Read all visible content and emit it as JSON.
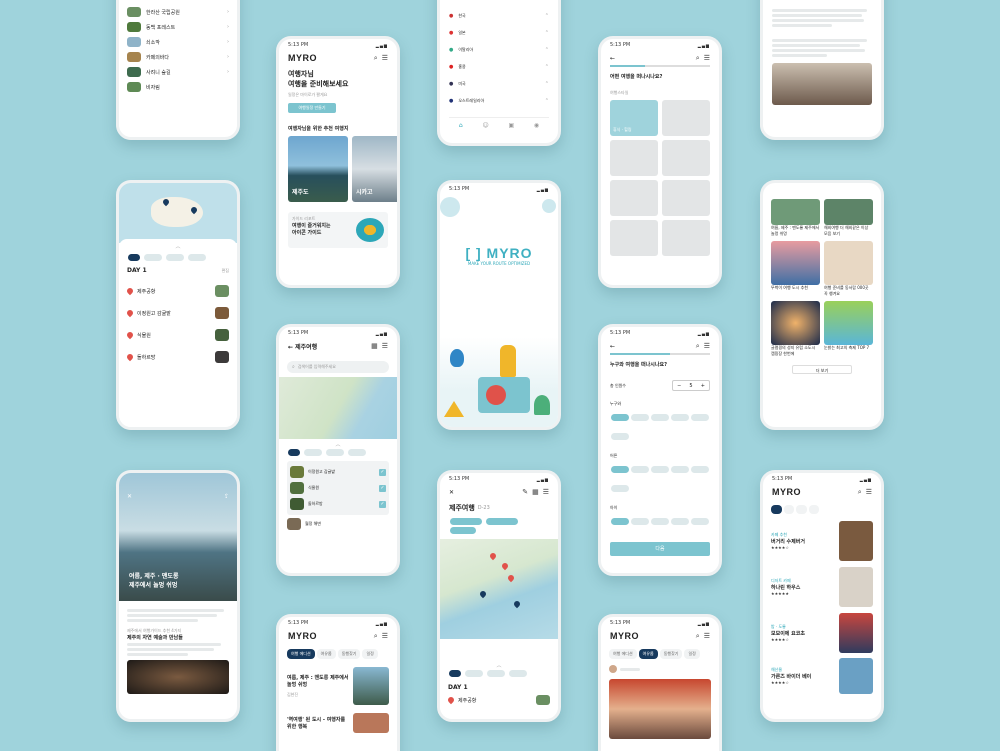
{
  "status_time": "5:13 PM",
  "brand": "MYRO",
  "brand_tagline": "MAKE YOUR ROUTE OPTIMIZED",
  "home": {
    "greeting_line1": "여행자님",
    "greeting_line2": "여행을 준비해보세요",
    "subtitle": "일정은 마이로가 짤게요",
    "cta": "여행일정 만들기",
    "rec_title": "여행자님을 위한 추천 여행지",
    "rec_cards": [
      "제주도",
      "시카고"
    ],
    "guide_small": "가이드 리포트",
    "guide_line1": "여행이 즐거워지는",
    "guide_line2": "아이콘 가이드"
  },
  "countries": [
    "한국",
    "일본",
    "이탈리아",
    "홍콩",
    "미국",
    "오스트레일리아"
  ],
  "list_top": [
    "한라산 국립공원",
    "동백 포레스트",
    "쇠소깍",
    "카페의바다",
    "사려니 숲길",
    "비자림"
  ],
  "style_quiz": {
    "question": "어떤 여행을 떠나시나요?",
    "section": "여행스타일",
    "first_tile": "휴식 · 힐링"
  },
  "people_quiz": {
    "question": "누구와 여행을 떠나시나요?",
    "count_label": "총 인원수",
    "count": "5",
    "sec_who": "누구와",
    "sec_age": "어른",
    "sec_kids": "아이",
    "next": "다음"
  },
  "jeju": {
    "back_title": "제주여행",
    "search_placeholder": "검색어를 입력해주세요",
    "places": [
      "이정원고 감귤밭",
      "식물원",
      "돌하르방",
      "월정 해변"
    ]
  },
  "itinerary": {
    "day": "DAY 1",
    "edit": "편집",
    "stops": [
      "제주공항",
      "이정원고 감귤밭",
      "식물원",
      "돌하르방"
    ]
  },
  "article": {
    "hero_line1": "여름, 제주 · 맨도롱",
    "hero_line2": "제주에서 놀멍 쉬멍",
    "sub_small": "제주에서 여행가이드 추천 4가지",
    "sub_title": "제주의 자연 예술과 만남들"
  },
  "trip_detail": {
    "title": "제주여행",
    "dday": "D-23",
    "day": "DAY 1",
    "stop": "제주공항"
  },
  "feed_tabs": [
    "여행 에디션",
    "여유롭",
    "동행찾기",
    "일정"
  ],
  "feed_cards": [
    {
      "title": "여름, 제주 : 맨도롱 제주에서 놀멍 쉬멍",
      "author": "김현진"
    },
    {
      "title": "'역여행' 된 도시 - 여행자를 위한 행복",
      "author": ""
    }
  ],
  "grid_cards": [
    "여름, 제주 : 맨도롱 제주에서 놀멍 쉬멍",
    "해외여행 더 해외같은 이상 모음 보기",
    "뚜벅이 여행 도시 추천",
    "여행 준비를 동서랍 000곳 꼭 챙겨요",
    "글램핑의 성지 유럽 소도시 캠핑장 한번에",
    "눈밝는 최고의 축제 TOP 7"
  ],
  "cafe_list": [
    {
      "tag": "카페 추천",
      "name": "버거리 수제버거",
      "stars": "★★★★☆"
    },
    {
      "tag": "디저트 카페",
      "name": "하나린 하우스",
      "stars": "★★★★★"
    },
    {
      "tag": "밤 · 도롱",
      "name": "모모이에 요코초",
      "stars": "★★★★☆"
    },
    {
      "tag": "해산물",
      "name": "가른즈 바이더 베이",
      "stars": "★★★★☆"
    }
  ],
  "more_label": "더 보기",
  "colors": {
    "background": "#9fd3dc",
    "accent": "#7cc4cf",
    "navy": "#173a5e"
  }
}
